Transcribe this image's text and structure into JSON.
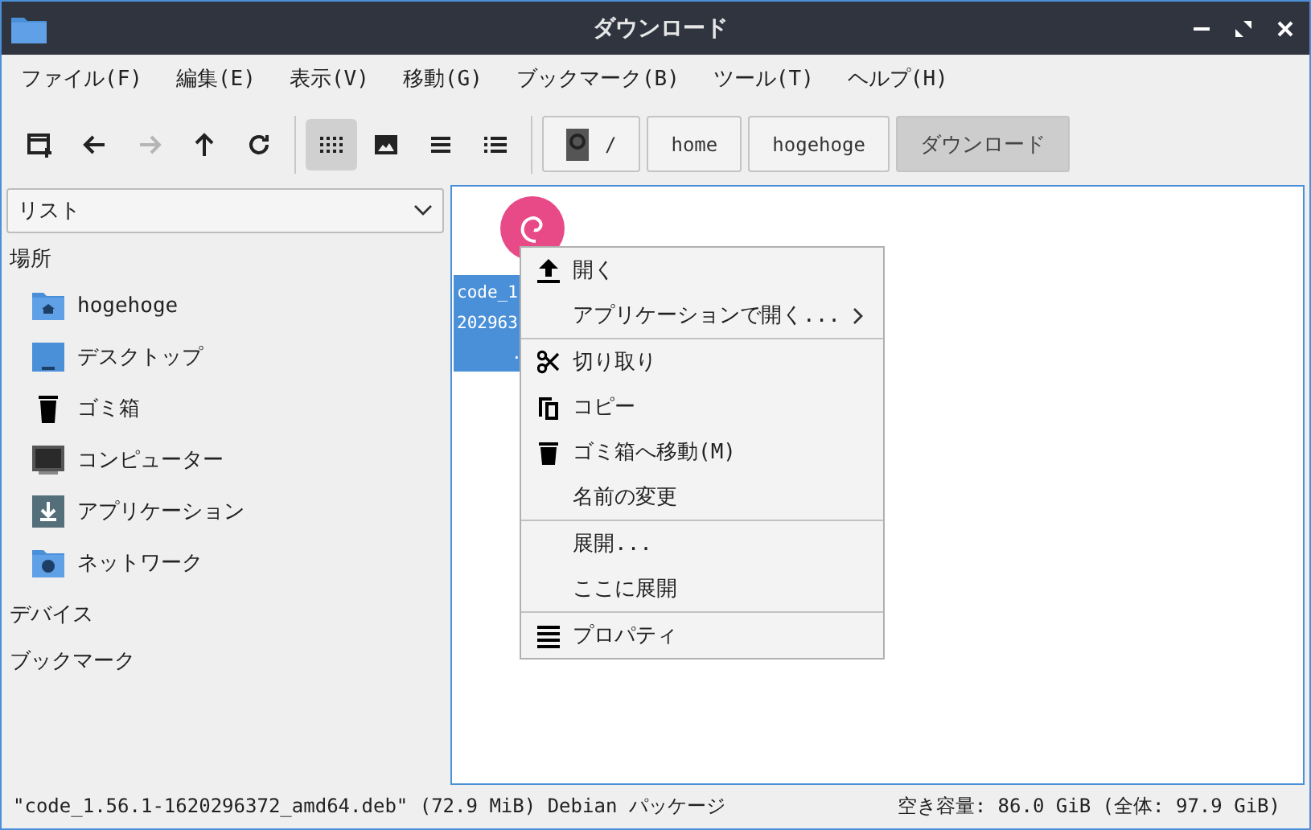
{
  "window": {
    "title": "ダウンロード"
  },
  "menu_bar": [
    "ファイル(F)",
    "編集(E)",
    "表示(V)",
    "移動(G)",
    "ブックマーク(B)",
    "ツール(T)",
    "ヘルプ(H)"
  ],
  "toolbar": {
    "nav_buttons": [
      {
        "disabled": false
      },
      {
        "disabled": false
      },
      {
        "disabled": true
      },
      {
        "disabled": false
      },
      {
        "disabled": false
      }
    ],
    "view_buttons": [
      {
        "selected": true
      },
      {
        "selected": false
      },
      {
        "selected": false
      },
      {
        "selected": false
      }
    ],
    "path": [
      {
        "label": "/",
        "selected": false
      },
      {
        "label": "home",
        "selected": false
      },
      {
        "label": "hogehoge",
        "selected": false
      },
      {
        "label": "ダウンロード",
        "selected": true
      }
    ]
  },
  "sidebar": {
    "mode": "リスト",
    "sections": [
      {
        "title": "場所",
        "items": [
          "hogehoge",
          "デスクトップ",
          "ゴミ箱",
          "コンピューター",
          "アプリケーション",
          "ネットワーク"
        ]
      },
      {
        "title": "デバイス"
      },
      {
        "title": "ブックマーク"
      }
    ]
  },
  "files": [
    {
      "name_lines": [
        "code_1",
        "202963",
        "."
      ],
      "selected": true
    }
  ],
  "context_menu": {
    "groups": [
      [
        {
          "label": "開く",
          "has_submenu": false
        },
        {
          "label": "アプリケーションで開く...",
          "has_submenu": true
        }
      ],
      [
        {
          "label": "切り取り",
          "has_submenu": false
        },
        {
          "label": "コピー",
          "has_submenu": false
        },
        {
          "label": "ゴミ箱へ移動(M)",
          "has_submenu": false
        },
        {
          "label": "名前の変更",
          "has_submenu": false
        }
      ],
      [
        {
          "label": "展開...",
          "has_submenu": false
        },
        {
          "label": "ここに展開",
          "has_submenu": false
        }
      ],
      [
        {
          "label": "プロパティ",
          "has_submenu": false
        }
      ]
    ]
  },
  "status_bar": {
    "left": "\"code_1.56.1-1620296372_amd64.deb\" (72.9 MiB) Debian パッケージ",
    "right": "空き容量: 86.0 GiB (全体: 97.9 GiB)"
  }
}
